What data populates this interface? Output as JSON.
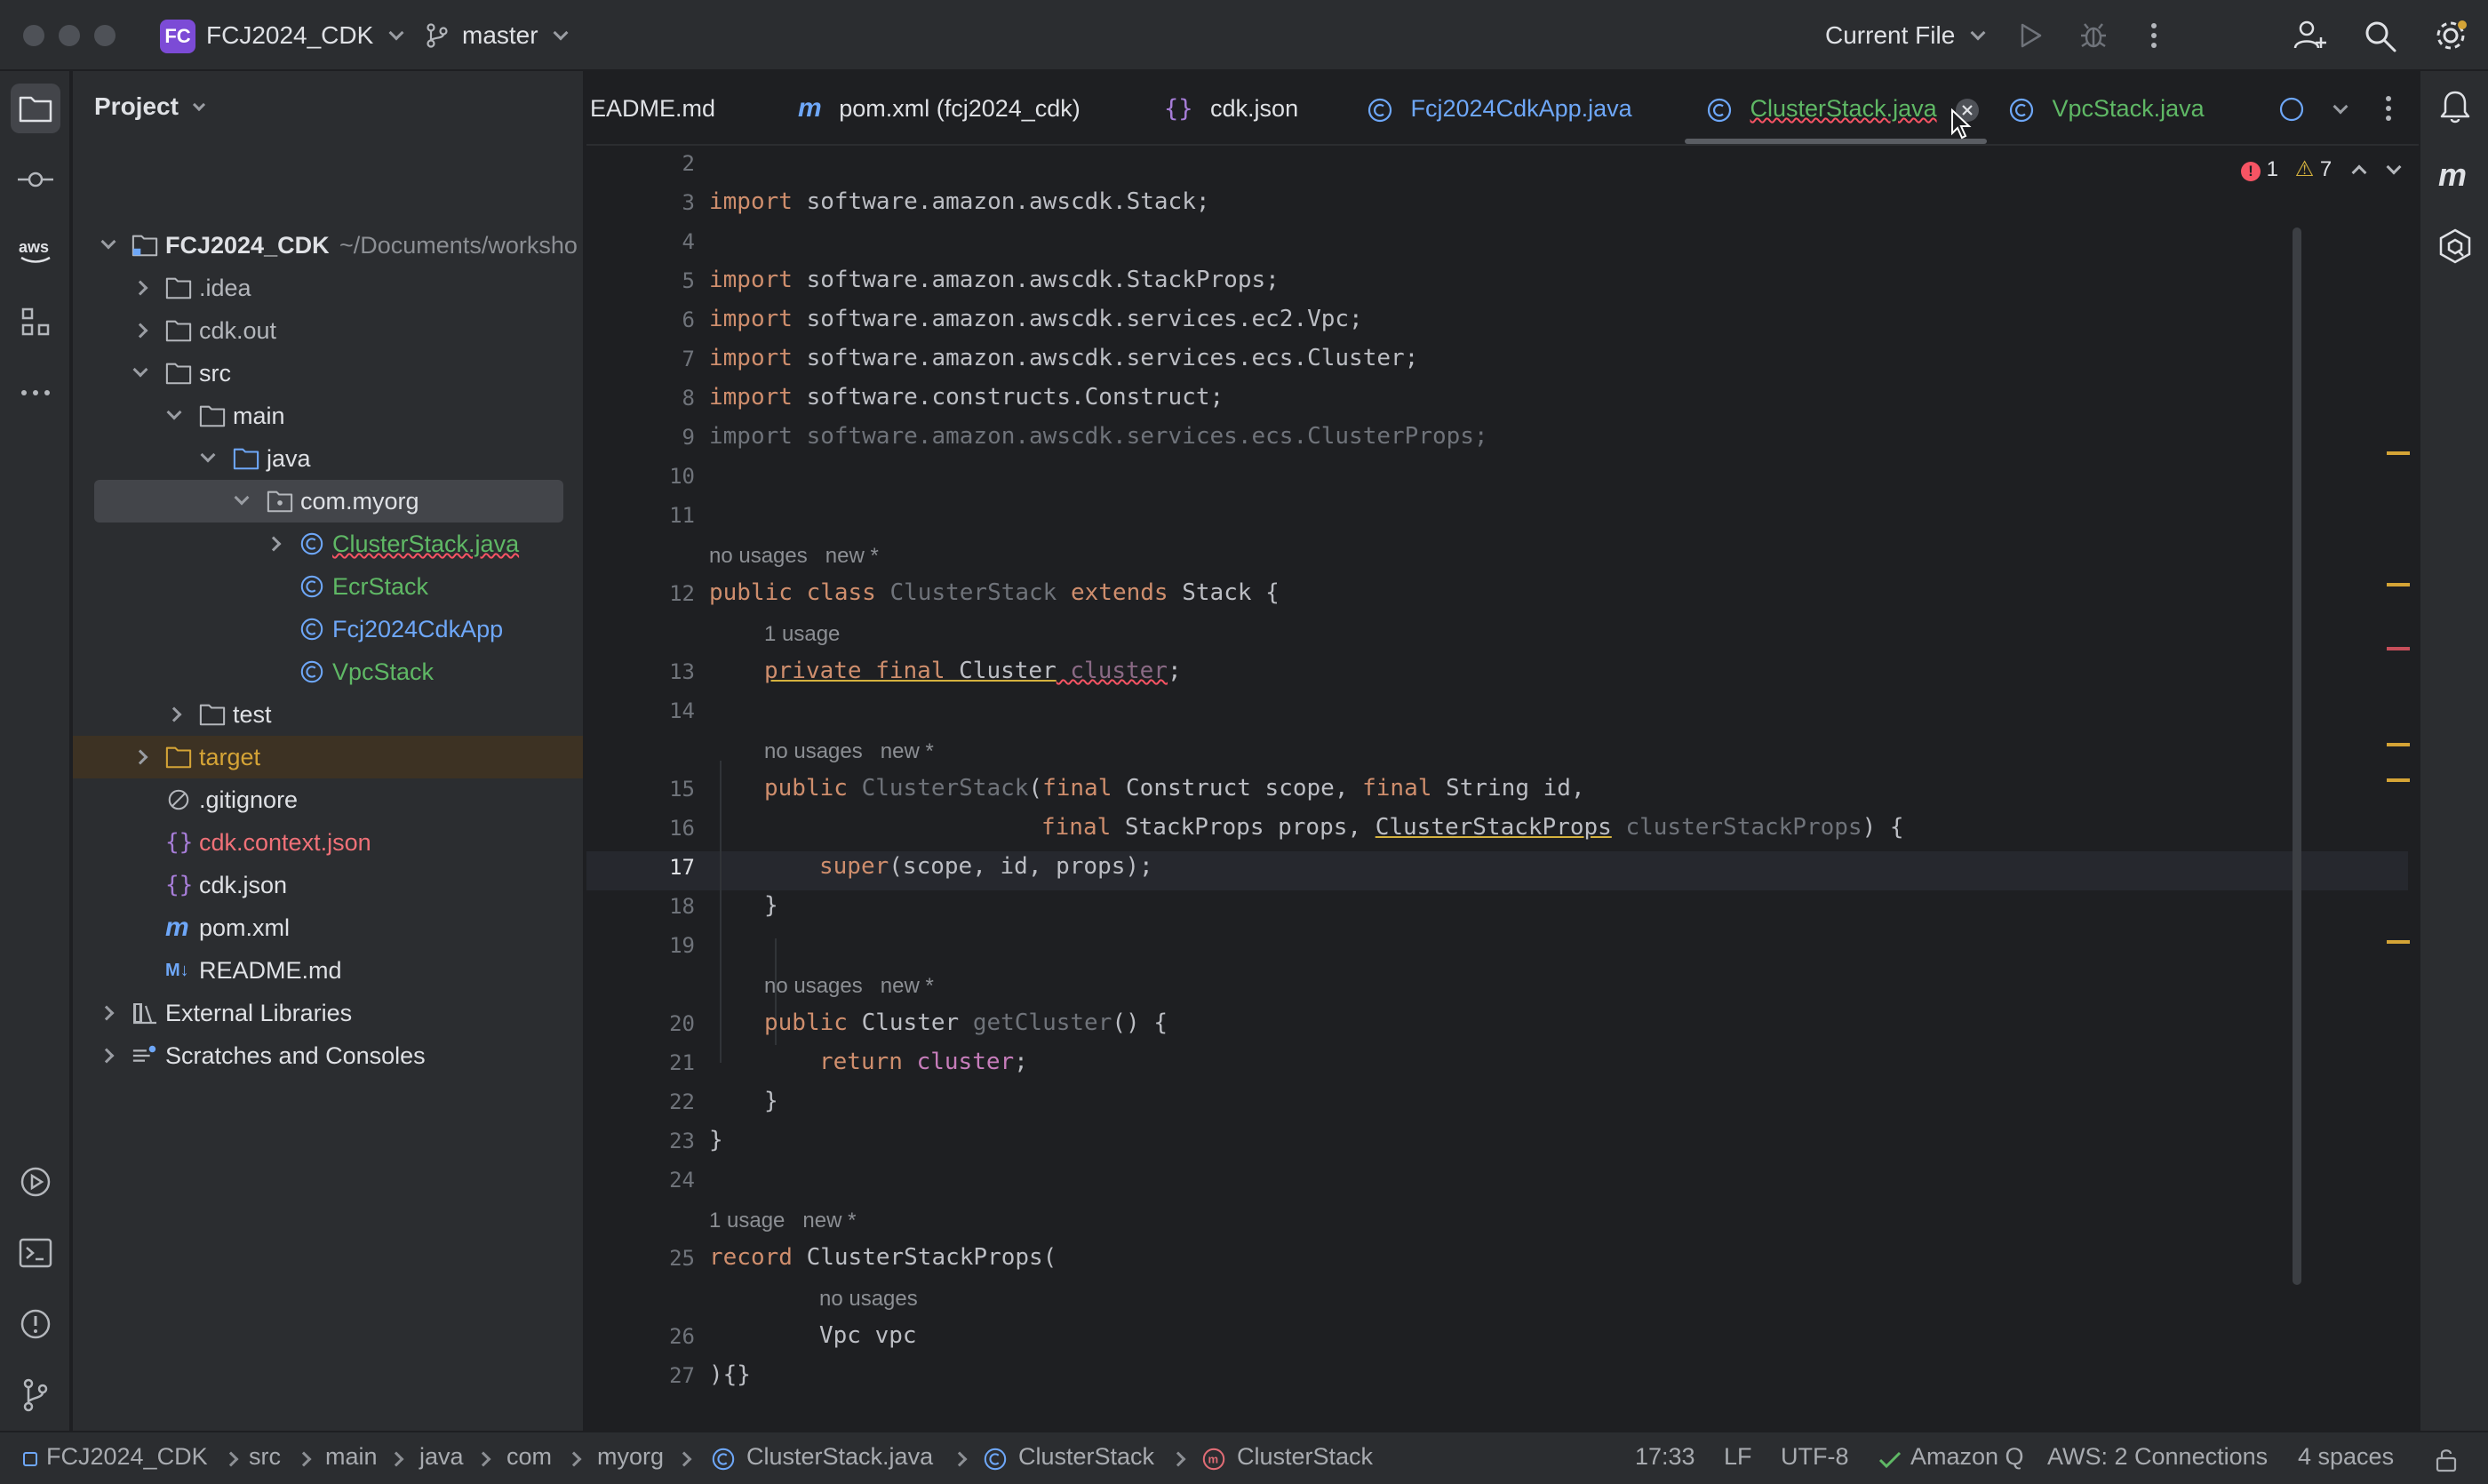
{
  "titlebar": {
    "project_badge": "FC",
    "project_name": "FCJ2024_CDK",
    "branch": "master",
    "run_config": "Current File"
  },
  "project_panel": {
    "title": "Project",
    "tree": [
      {
        "label": "FCJ2024_CDK",
        "path": "~/Documents/worksho",
        "kind": "module"
      },
      {
        "label": ".idea",
        "kind": "folder"
      },
      {
        "label": "cdk.out",
        "kind": "folder"
      },
      {
        "label": "src",
        "kind": "folder"
      },
      {
        "label": "main",
        "kind": "folder"
      },
      {
        "label": "java",
        "kind": "source-folder"
      },
      {
        "label": "com.myorg",
        "kind": "package"
      },
      {
        "label": "ClusterStack.java",
        "kind": "class"
      },
      {
        "label": "EcrStack",
        "kind": "class"
      },
      {
        "label": "Fcj2024CdkApp",
        "kind": "class"
      },
      {
        "label": "VpcStack",
        "kind": "class"
      },
      {
        "label": "test",
        "kind": "folder"
      },
      {
        "label": "target",
        "kind": "folder-excluded"
      },
      {
        "label": ".gitignore",
        "kind": "ignore"
      },
      {
        "label": "cdk.context.json",
        "kind": "json"
      },
      {
        "label": "cdk.json",
        "kind": "json"
      },
      {
        "label": "pom.xml",
        "kind": "maven"
      },
      {
        "label": "README.md",
        "kind": "markdown"
      },
      {
        "label": "External Libraries",
        "kind": "library"
      },
      {
        "label": "Scratches and Consoles",
        "kind": "scratch"
      }
    ]
  },
  "tabs": [
    {
      "label": "EADME.md"
    },
    {
      "label": "pom.xml (fcj2024_cdk)"
    },
    {
      "label": "cdk.json"
    },
    {
      "label": "Fcj2024CdkApp.java"
    },
    {
      "label": "ClusterStack.java",
      "active": true
    },
    {
      "label": "VpcStack.java"
    }
  ],
  "inspections": {
    "errors": "1",
    "warnings": "7"
  },
  "editor": {
    "lines": [
      {
        "n": "2"
      },
      {
        "n": "3"
      },
      {
        "n": "4"
      },
      {
        "n": "5"
      },
      {
        "n": "6"
      },
      {
        "n": "7"
      },
      {
        "n": "8"
      },
      {
        "n": "9"
      },
      {
        "n": "10"
      },
      {
        "n": "11"
      },
      {
        "n": "12"
      },
      {
        "n": "13"
      },
      {
        "n": "14"
      },
      {
        "n": "15"
      },
      {
        "n": "16"
      },
      {
        "n": "17"
      },
      {
        "n": "18"
      },
      {
        "n": "19"
      },
      {
        "n": "20"
      },
      {
        "n": "21"
      },
      {
        "n": "22"
      },
      {
        "n": "23"
      },
      {
        "n": "24"
      },
      {
        "n": "25"
      },
      {
        "n": "26"
      },
      {
        "n": "27"
      }
    ],
    "hints": {
      "h12": "no usages   new *",
      "h13": "1 usage",
      "h15": "no usages   new *",
      "h20": "no usages   new *",
      "h25": "1 usage   new *",
      "h26": "no usages"
    },
    "code": {
      "l3a": "import",
      "l3b": " software.amazon.awscdk.Stack;",
      "l5a": "import",
      "l5b": " software.amazon.awscdk.StackProps;",
      "l6a": "import",
      "l6b": " software.amazon.awscdk.services.ec2.Vpc;",
      "l7a": "import",
      "l7b": " software.amazon.awscdk.services.ecs.Cluster;",
      "l8a": "import",
      "l8b": " software.constructs.Construct;",
      "l9": "import software.amazon.awscdk.services.ecs.ClusterProps;",
      "l12a": "public class",
      "l12b": " ClusterStack",
      "l12c": " extends",
      "l12d": " Stack {",
      "l13a": "private final",
      "l13b": " Cluster",
      "l13c": " cluster",
      "l13d": ";",
      "l15a": "public",
      "l15b": " ClusterStack",
      "l15c": "(",
      "l15d": "final",
      "l15e": " Construct scope, ",
      "l15f": "final",
      "l15g": " String id,",
      "l16a": "final",
      "l16b": " StackProps props, ",
      "l16c": "ClusterStackProps",
      "l16d": " clusterStackProps",
      "l16e": ") {",
      "l17a": "super",
      "l17b": "(scope, id, props);",
      "l18": "}",
      "l20a": "public",
      "l20b": " Cluster ",
      "l20c": "getCluster",
      "l20d": "() {",
      "l21a": "return",
      "l21b": " cluster",
      "l21c": ";",
      "l22": "}",
      "l23": "}",
      "l25a": "record",
      "l25b": " ClusterStackProps(",
      "l26": "Vpc vpc",
      "l27": "){}"
    }
  },
  "statusbar": {
    "breadcrumbs": [
      "FCJ2024_CDK",
      "src",
      "main",
      "java",
      "com",
      "myorg",
      "ClusterStack.java",
      "ClusterStack",
      "ClusterStack"
    ],
    "position": "17:33",
    "line_sep": "LF",
    "encoding": "UTF-8",
    "amazon_q": "Amazon Q",
    "aws": "AWS: 2 Connections",
    "indent": "4 spaces"
  },
  "colors": {
    "background": "#1e1f22",
    "panel": "#2b2d30",
    "keyword": "#cf8e6d",
    "field": "#c77dbb",
    "method": "#56a8f5",
    "class_link": "#56a8f5",
    "green_class": "#5fb865",
    "vcs_modified": "#6ea7f8",
    "error": "#f75464",
    "warning": "#d5b23e"
  }
}
